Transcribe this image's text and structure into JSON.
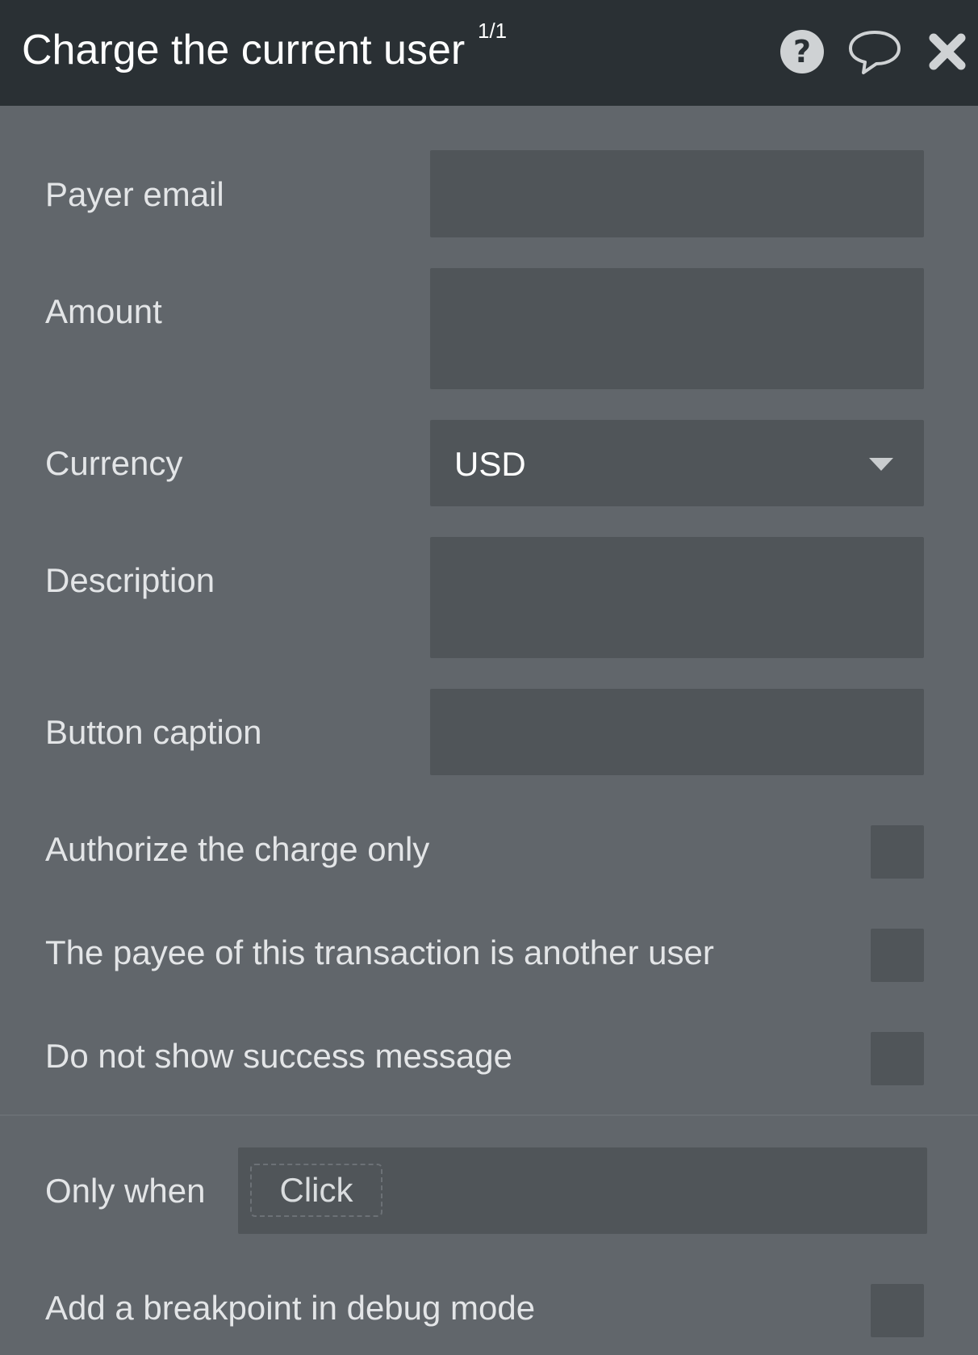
{
  "header": {
    "title": "Charge the current user",
    "counter": "1/1",
    "icons": [
      "help-icon",
      "comment-icon",
      "close-icon"
    ]
  },
  "fields": {
    "payer_email": {
      "label": "Payer email",
      "value": ""
    },
    "amount": {
      "label": "Amount",
      "value": ""
    },
    "currency": {
      "label": "Currency",
      "value": "USD"
    },
    "description": {
      "label": "Description",
      "value": ""
    },
    "button_caption": {
      "label": "Button caption",
      "value": ""
    }
  },
  "checkboxes": {
    "authorize_only": {
      "label": "Authorize the charge only",
      "checked": false
    },
    "payee_other_user": {
      "label": "The payee of this transaction is another user",
      "checked": false
    },
    "no_success_message": {
      "label": "Do not show success message",
      "checked": false
    }
  },
  "condition": {
    "label": "Only when",
    "placeholder": "Click"
  },
  "debug": {
    "label": "Add a breakpoint in debug mode",
    "checked": false
  }
}
